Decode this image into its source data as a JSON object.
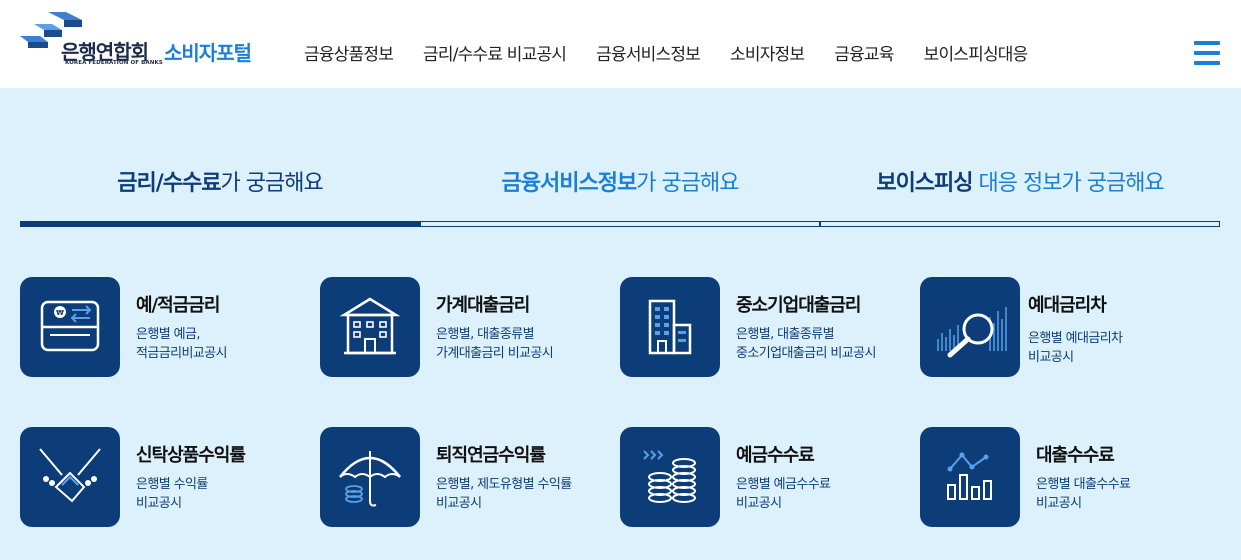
{
  "header": {
    "logo_kfb": "은행연합회",
    "logo_eng": "KOREA FEDERATION OF BANKS",
    "logo_portal": "소비자포털",
    "nav": [
      "금융상품정보",
      "금리/수수료 비교공시",
      "금융서비스정보",
      "소비자정보",
      "금융교육",
      "보이스피싱대응"
    ]
  },
  "tabs": [
    {
      "bold": "금리/수수료",
      "rest": "가 궁금해요",
      "active": true
    },
    {
      "bold": "금융서비스정보",
      "rest": "가 궁금해요",
      "active": false
    },
    {
      "bold": "보이스피싱",
      "rest": " 대응 정보가 궁금해요",
      "active": false
    }
  ],
  "cards": [
    {
      "title": "예/적금금리",
      "desc1": "은행별 예금,",
      "desc2": "적금금리비교공시",
      "icon": "deposit-card-icon"
    },
    {
      "title": "가계대출금리",
      "desc1": "은행별, 대출종류별",
      "desc2": "가계대출금리 비교공시",
      "icon": "house-icon"
    },
    {
      "title": "중소기업대출금리",
      "desc1": "은행별, 대출종류별",
      "desc2": "중소기업대출금리 비교공시",
      "icon": "building-icon"
    },
    {
      "title": "예대금리차",
      "desc1": "은행별 예대금리차",
      "desc2": "비교공시",
      "icon": "magnifier-icon"
    },
    {
      "title": "신탁상품수익률",
      "desc1": "은행별 수익률",
      "desc2": "비교공시",
      "icon": "handshake-icon"
    },
    {
      "title": "퇴직연금수익률",
      "desc1": "은행별, 제도유형별 수익률",
      "desc2": "비교공시",
      "icon": "umbrella-icon"
    },
    {
      "title": "예금수수료",
      "desc1": "은행별 예금수수료",
      "desc2": "비교공시",
      "icon": "coin-stack-icon"
    },
    {
      "title": "대출수수료",
      "desc1": "은행별 대출수수료",
      "desc2": "비교공시",
      "icon": "bar-chart-icon"
    }
  ],
  "colors": {
    "navy": "#0d3d78",
    "accent": "#1b7fd3",
    "bg": "#dcf1fc"
  }
}
